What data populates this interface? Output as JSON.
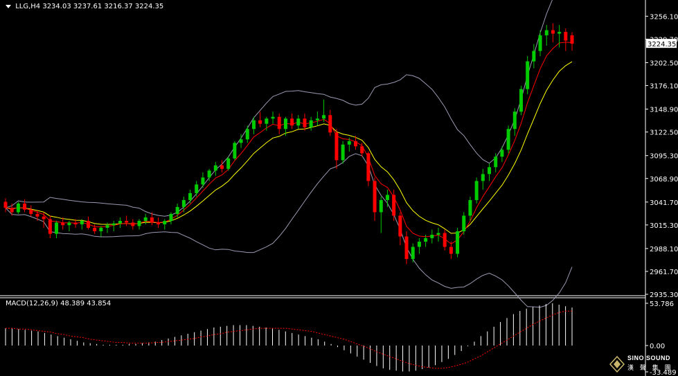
{
  "header": {
    "symbol": "LLG,H4",
    "ohlc": "3234.03 3237.61 3216.37 3224.35"
  },
  "macd_header": {
    "label": "MACD(12,26,9) 48.389 43.854"
  },
  "watermark": {
    "line1": "SINO SOUND",
    "line2": "漢 聲 集 團"
  },
  "colors": {
    "background": "#000000",
    "bull": "#00cc00",
    "bear": "#ff0000",
    "ma_fast": "#ff0000",
    "ma_slow": "#ffff00",
    "bollinger": "#9a9ab4",
    "macd_hist": "#ffffff",
    "macd_signal": "#ff0000",
    "axis": "#ffffff",
    "price_box": "#ffffff"
  },
  "chart_data": [
    {
      "type": "candlestick",
      "price_ticks": [
        3256.1,
        3229.7,
        3202.5,
        3176.1,
        3148.9,
        3122.5,
        3095.3,
        3068.9,
        3041.7,
        3015.3,
        2988.1,
        2961.7,
        2935.3
      ],
      "price_tick_labels": [
        "3256.10",
        "3229.70",
        "3202.50",
        "3176.10",
        "3148.90",
        "3122.50",
        "3095.30",
        "3068.90",
        "3041.70",
        "3015.30",
        "2988.10",
        "2961.70",
        "2935.30"
      ],
      "ylim": [
        2935.3,
        3270.0
      ],
      "last_price": 3224.35,
      "last_price_label": "3224.35",
      "candles": [
        [
          3042,
          3046,
          3030,
          3035
        ],
        [
          3035,
          3040,
          3026,
          3030
        ],
        [
          3030,
          3042,
          3028,
          3040
        ],
        [
          3040,
          3045,
          3030,
          3033
        ],
        [
          3033,
          3038,
          3025,
          3028
        ],
        [
          3028,
          3032,
          3020,
          3025
        ],
        [
          3025,
          3030,
          3012,
          3022
        ],
        [
          3022,
          3026,
          3000,
          3005
        ],
        [
          3005,
          3020,
          3000,
          3018
        ],
        [
          3018,
          3024,
          3010,
          3015
        ],
        [
          3015,
          3020,
          3008,
          3018
        ],
        [
          3018,
          3022,
          3012,
          3016
        ],
        [
          3016,
          3022,
          3010,
          3020
        ],
        [
          3020,
          3025,
          3010,
          3012
        ],
        [
          3012,
          3016,
          3005,
          3008
        ],
        [
          3008,
          3014,
          3002,
          3012
        ],
        [
          3012,
          3018,
          3006,
          3015
        ],
        [
          3015,
          3020,
          3008,
          3017
        ],
        [
          3017,
          3024,
          3012,
          3020
        ],
        [
          3020,
          3026,
          3014,
          3018
        ],
        [
          3018,
          3022,
          3010,
          3014
        ],
        [
          3014,
          3022,
          3010,
          3020
        ],
        [
          3020,
          3028,
          3016,
          3024
        ],
        [
          3024,
          3030,
          3015,
          3018
        ],
        [
          3018,
          3024,
          3012,
          3016
        ],
        [
          3016,
          3022,
          3010,
          3020
        ],
        [
          3020,
          3030,
          3016,
          3028
        ],
        [
          3028,
          3040,
          3024,
          3036
        ],
        [
          3036,
          3048,
          3030,
          3044
        ],
        [
          3044,
          3056,
          3040,
          3052
        ],
        [
          3052,
          3066,
          3048,
          3062
        ],
        [
          3062,
          3076,
          3058,
          3070
        ],
        [
          3070,
          3080,
          3066,
          3078
        ],
        [
          3078,
          3088,
          3072,
          3084
        ],
        [
          3084,
          3090,
          3076,
          3080
        ],
        [
          3080,
          3094,
          3078,
          3092
        ],
        [
          3092,
          3112,
          3090,
          3110
        ],
        [
          3110,
          3120,
          3104,
          3114
        ],
        [
          3114,
          3130,
          3110,
          3126
        ],
        [
          3126,
          3140,
          3120,
          3136
        ],
        [
          3136,
          3146,
          3128,
          3132
        ],
        [
          3132,
          3140,
          3124,
          3138
        ],
        [
          3138,
          3146,
          3132,
          3140
        ],
        [
          3140,
          3144,
          3120,
          3126
        ],
        [
          3126,
          3140,
          3118,
          3138
        ],
        [
          3138,
          3144,
          3126,
          3130
        ],
        [
          3130,
          3142,
          3126,
          3138
        ],
        [
          3138,
          3144,
          3124,
          3128
        ],
        [
          3128,
          3140,
          3124,
          3136
        ],
        [
          3136,
          3146,
          3130,
          3138
        ],
        [
          3138,
          3160,
          3134,
          3142
        ],
        [
          3142,
          3148,
          3118,
          3122
        ],
        [
          3122,
          3126,
          3080,
          3090
        ],
        [
          3090,
          3112,
          3086,
          3108
        ],
        [
          3108,
          3116,
          3100,
          3112
        ],
        [
          3112,
          3118,
          3102,
          3106
        ],
        [
          3106,
          3110,
          3094,
          3098
        ],
        [
          3098,
          3100,
          3060,
          3066
        ],
        [
          3066,
          3070,
          3020,
          3030
        ],
        [
          3030,
          3048,
          3006,
          3044
        ],
        [
          3044,
          3056,
          3036,
          3050
        ],
        [
          3050,
          3056,
          3020,
          3026
        ],
        [
          3026,
          3030,
          2992,
          3002
        ],
        [
          3002,
          3008,
          2970,
          2976
        ],
        [
          2976,
          2994,
          2972,
          2990
        ],
        [
          2990,
          3000,
          2982,
          2996
        ],
        [
          2996,
          3004,
          2990,
          3000
        ],
        [
          3000,
          3010,
          2994,
          3004
        ],
        [
          3004,
          3012,
          2996,
          3006
        ],
        [
          3006,
          3010,
          2986,
          2990
        ],
        [
          2990,
          2996,
          2976,
          2982
        ],
        [
          2982,
          3012,
          2978,
          3008
        ],
        [
          3008,
          3030,
          3004,
          3026
        ],
        [
          3026,
          3048,
          3020,
          3044
        ],
        [
          3044,
          3070,
          3040,
          3066
        ],
        [
          3066,
          3080,
          3056,
          3074
        ],
        [
          3074,
          3086,
          3066,
          3082
        ],
        [
          3082,
          3098,
          3076,
          3094
        ],
        [
          3094,
          3106,
          3088,
          3102
        ],
        [
          3102,
          3130,
          3098,
          3126
        ],
        [
          3126,
          3150,
          3118,
          3146
        ],
        [
          3146,
          3176,
          3142,
          3172
        ],
        [
          3172,
          3210,
          3166,
          3204
        ],
        [
          3204,
          3224,
          3196,
          3216
        ],
        [
          3216,
          3240,
          3210,
          3234
        ],
        [
          3234,
          3246,
          3222,
          3240
        ],
        [
          3240,
          3248,
          3226,
          3236
        ],
        [
          3236,
          3246,
          3220,
          3238
        ],
        [
          3238,
          3242,
          3216,
          3228
        ],
        [
          3234.03,
          3237.61,
          3216.37,
          3224.35
        ]
      ]
    },
    {
      "type": "bar",
      "title": "MACD(12,26,9)",
      "values_text": "48.389 43.854",
      "axis_ticks": [
        53.786,
        0.0,
        -33.489
      ],
      "axis_tick_labels": [
        "53.786",
        "0.00",
        "-33.489"
      ],
      "ylim": [
        -33.489,
        53.786
      ],
      "histogram": [
        22,
        22,
        21,
        20,
        19,
        18,
        16,
        14,
        12,
        10,
        8,
        6,
        4,
        3,
        2,
        1,
        1,
        1,
        1,
        2,
        2,
        3,
        4,
        5,
        7,
        9,
        11,
        13,
        15,
        17,
        19,
        21,
        23,
        24,
        25,
        26,
        26,
        26,
        25,
        24,
        23,
        22,
        20,
        18,
        16,
        14,
        12,
        10,
        8,
        5,
        2,
        -2,
        -6,
        -10,
        -14,
        -18,
        -22,
        -26,
        -29,
        -31,
        -32,
        -33,
        -33,
        -32,
        -30,
        -28,
        -25,
        -21,
        -17,
        -12,
        -7,
        -1,
        5,
        12,
        18,
        24,
        30,
        35,
        40,
        44,
        47,
        49,
        51,
        53,
        53.786,
        52,
        50,
        48.389
      ],
      "signal": [
        22,
        22,
        21,
        21,
        20,
        19,
        18,
        17,
        15,
        14,
        12,
        11,
        10,
        8,
        7,
        6,
        5,
        4,
        4,
        3,
        3,
        3,
        3,
        4,
        4,
        5,
        6,
        7,
        8,
        9,
        11,
        12,
        14,
        15,
        17,
        18,
        19,
        20,
        21,
        22,
        22,
        22,
        22,
        22,
        21,
        20,
        19,
        18,
        16,
        14,
        12,
        10,
        8,
        5,
        2,
        -1,
        -4,
        -8,
        -11,
        -14,
        -17,
        -20,
        -23,
        -25,
        -27,
        -28,
        -29,
        -29,
        -28,
        -26,
        -24,
        -21,
        -17,
        -13,
        -8,
        -3,
        2,
        7,
        12,
        17,
        22,
        27,
        31,
        35,
        39,
        42,
        43.854,
        43.854
      ]
    }
  ]
}
